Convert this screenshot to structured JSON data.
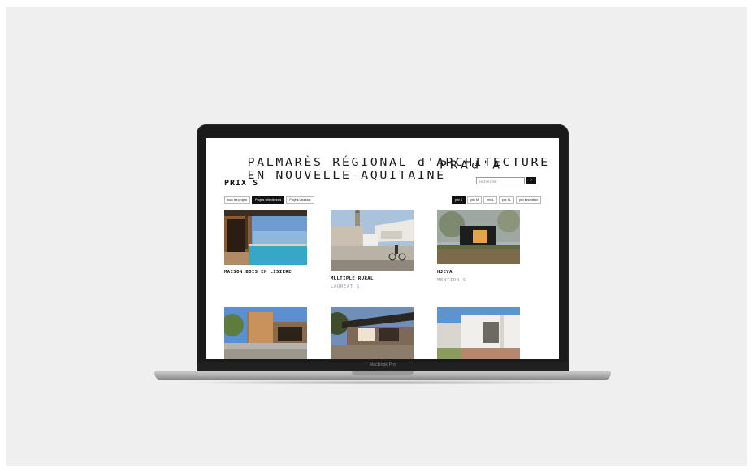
{
  "site": {
    "title_line1": "PALMARÈS RÉGIONAL d'ARCHITECTURE",
    "title_line2": "EN NOUVELLE-AQUITAINE",
    "logo": "PRAd'A"
  },
  "page": {
    "heading": "PRIX S"
  },
  "search": {
    "placeholder": "rechercher",
    "button_label": ">"
  },
  "filters": [
    {
      "label": "tous les projets",
      "active": false
    },
    {
      "label": "Projets sélectionnés",
      "active": true
    },
    {
      "label": "Projets Lauréats",
      "active": false
    }
  ],
  "prize_filters": [
    {
      "label": "prix S",
      "active": true
    },
    {
      "label": "prix M",
      "active": false
    },
    {
      "label": "prix L",
      "active": false
    },
    {
      "label": "prix XL",
      "active": false
    },
    {
      "label": "prix innovation",
      "active": false
    }
  ],
  "projects": [
    {
      "name": "MAISON BOIS EN LISIERE",
      "award": ""
    },
    {
      "name": "MULTIPLE RURAL",
      "award": "LAURÉAT S"
    },
    {
      "name": "HJEVA",
      "award": "MENTION S"
    },
    {
      "name": "",
      "award": ""
    },
    {
      "name": "",
      "award": ""
    },
    {
      "name": "",
      "award": ""
    }
  ],
  "device": {
    "label": "MacBook Pro"
  },
  "colors": {
    "backdrop": "#efefef",
    "laptop_frame": "#1a1a1a",
    "accent": "#111111"
  }
}
